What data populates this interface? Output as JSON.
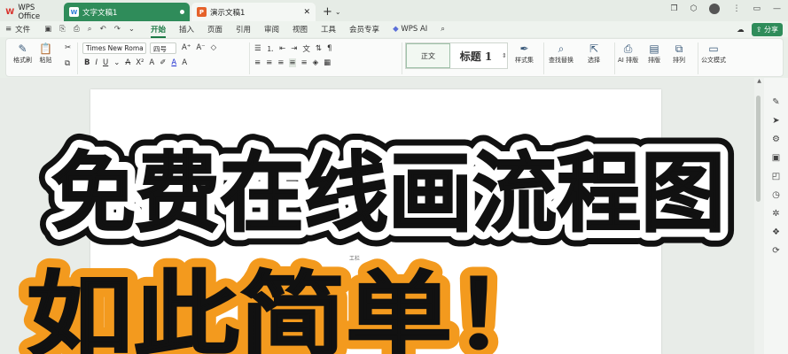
{
  "tabs": {
    "home": {
      "label": "WPS Office"
    },
    "doc": {
      "label": "文字文稿1"
    },
    "ppt": {
      "label": "演示文稿1"
    },
    "add": "+"
  },
  "menu": {
    "file": "文件",
    "items": [
      "开始",
      "插入",
      "页面",
      "引用",
      "审阅",
      "视图",
      "工具",
      "会员专享"
    ],
    "ai": "WPS AI",
    "share": "分享"
  },
  "ribbon": {
    "format_painter": "格式刷",
    "paste": "粘贴",
    "font_name": "Times New Roma",
    "font_size": "四号",
    "style_normal": "正文",
    "style_heading": "标题 1",
    "style_set": "样式集",
    "find_replace": "查找替换",
    "select": "选择",
    "ai_layout": "AI 排版",
    "layout": "排版",
    "arrange": "排列",
    "official": "公文模式"
  },
  "page": {
    "label": "工栏"
  },
  "overlay": {
    "line1": "免费在线画流程图",
    "line2": "如此简单！"
  },
  "colors": {
    "accent": "#2f8c5a",
    "overlay_orange": "#f39a1e",
    "overlay_black": "#111111"
  }
}
